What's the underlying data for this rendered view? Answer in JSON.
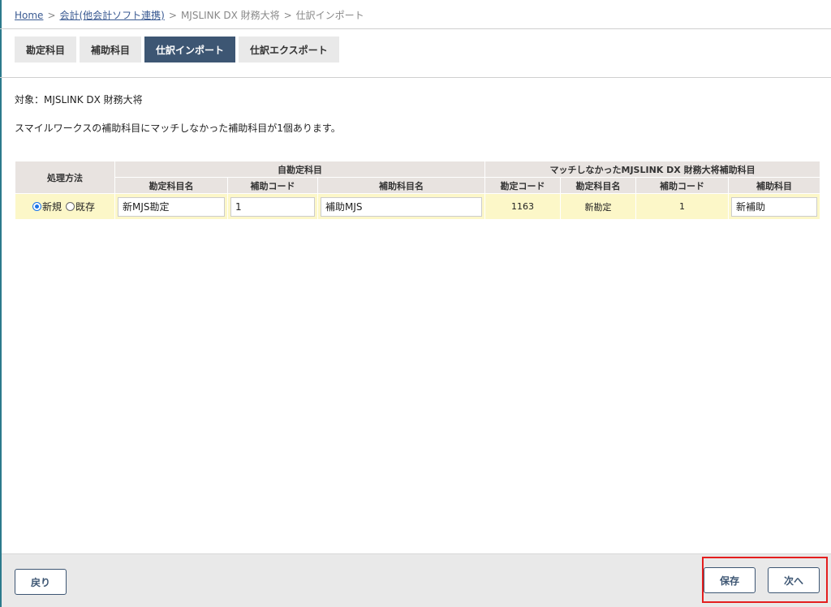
{
  "breadcrumb": {
    "home": "Home",
    "link": "会計(他会計ソフト連携)",
    "mid": "MJSLINK DX 財務大将",
    "current": "仕訳インポート",
    "sep": ">"
  },
  "tabs": [
    {
      "label": "勘定科目",
      "active": false
    },
    {
      "label": "補助科目",
      "active": false
    },
    {
      "label": "仕訳インポート",
      "active": true
    },
    {
      "label": "仕訳エクスポート",
      "active": false
    }
  ],
  "target_line": "対象：MJSLINK DX 財務大将",
  "message_line": "スマイルワークスの補助科目にマッチしなかった補助科目が1個あります。",
  "table": {
    "group_headers": {
      "method": "処理方法",
      "own": "自勘定科目",
      "unmatched": "マッチしなかったMJSLINK DX 財務大将補助科目"
    },
    "columns": {
      "own_account_name": "勘定科目名",
      "own_sub_code": "補助コード",
      "own_sub_name": "補助科目名",
      "um_account_code": "勘定コード",
      "um_account_name": "勘定科目名",
      "um_sub_code": "補助コード",
      "um_sub_name": "補助科目"
    },
    "row": {
      "radio_new": "新規",
      "radio_existing": "既存",
      "selected": "新規",
      "own_account_name": "新MJS勘定",
      "own_sub_code": "1",
      "own_sub_name": "補助MJS",
      "um_account_code": "1163",
      "um_account_name": "新勘定",
      "um_sub_code": "1",
      "um_sub_name": "新補助"
    }
  },
  "footer": {
    "back": "戻り",
    "save": "保存",
    "next": "次へ"
  },
  "colors": {
    "tab_active": "#3d5673",
    "row_bg": "#fcf7c8",
    "header_bg": "#e8e3e0",
    "highlight": "#e41f1f"
  }
}
